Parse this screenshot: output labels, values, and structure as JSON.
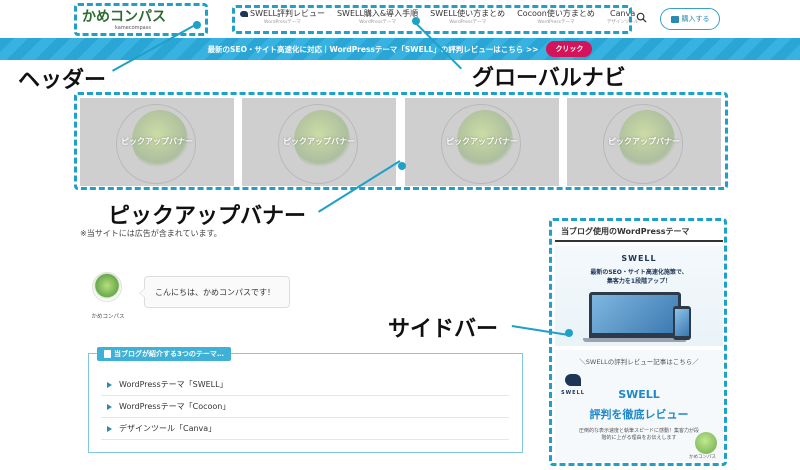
{
  "header": {
    "logo_text": "かめコンパス",
    "logo_sub": "kamecompass",
    "search_icon": "search-icon",
    "buy_button_label": "購入する",
    "nav": [
      {
        "label": "SWELL評判レビュー",
        "sub": "WordPressテーマ"
      },
      {
        "label": "SWELL購入&導入手順",
        "sub": "WordPressテーマ"
      },
      {
        "label": "SWELL使い方まとめ",
        "sub": "WordPressテーマ"
      },
      {
        "label": "Cocoon使い方まとめ",
        "sub": "WordPressテーマ"
      },
      {
        "label": "Canva",
        "sub": "デザインツール"
      }
    ]
  },
  "notice_bar": {
    "text": "最新のSEO・サイト高速化に対応｜WordPressテーマ「SWELL」の評判レビューはこちら >>",
    "button": "クリック"
  },
  "pickup_banners": [
    {
      "label": "ピックアップバナー"
    },
    {
      "label": "ピックアップバナー"
    },
    {
      "label": "ピックアップバナー"
    },
    {
      "label": "ピックアップバナー"
    }
  ],
  "main": {
    "ad_notice": "※当サイトには広告が含まれています。",
    "speech": {
      "avatar_name": "かめコンパス",
      "text": "こんにちは、かめコンパスです！"
    },
    "ranking": {
      "title": "当ブログが紹介する3つのテーマ…",
      "items": [
        "WordPressテーマ「SWELL」",
        "WordPressテーマ「Cocoon」",
        "デザインツール「Canva」"
      ]
    }
  },
  "sidebar": {
    "widget_title": "当ブログ使用のWordPressテーマ",
    "swell_ad": {
      "logo": "SWELL",
      "catch_line1": "最新のSEO・サイト高速化施策で、",
      "catch_line2": "集客力を1段階アップ！"
    },
    "review_ad": {
      "heading": "＼SWELLの評判レビュー記事はこちら／",
      "bird_label": "SWELL",
      "title_line1": "SWELL",
      "title_line2": "評判を徹底レビュー",
      "desc": "圧倒的な表示速度と執筆スピードに感動！集客力が段階的に上がる理由をお伝えします",
      "turtle_label": "かめコンパス"
    }
  },
  "annotations": {
    "header": "ヘッダー",
    "global_nav": "グローバルナビ",
    "pickup": "ピックアップバナー",
    "sidebar": "サイドバー"
  },
  "colors": {
    "accent": "#1ea0c8",
    "notice_bar": "#2aa6d6",
    "click_button": "#d4145a",
    "ranking_title": "#3fb0d6",
    "review_title": "#1e88c8"
  }
}
